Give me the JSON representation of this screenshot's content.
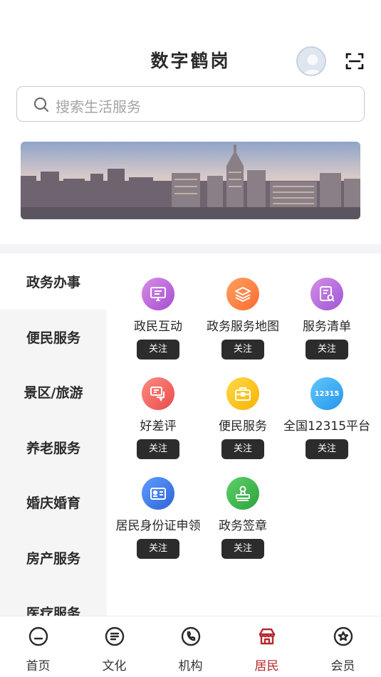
{
  "header": {
    "title": "数字鹤岗",
    "avatar_icon": "avatar",
    "scan_icon": "scan-icon"
  },
  "search": {
    "placeholder": "搜索生活服务"
  },
  "sidebar": {
    "items": [
      {
        "label": "政务办事",
        "active": true
      },
      {
        "label": "便民服务",
        "active": false
      },
      {
        "label": "景区/旅游",
        "active": false
      },
      {
        "label": "养老服务",
        "active": false
      },
      {
        "label": "婚庆婚育",
        "active": false
      },
      {
        "label": "房产服务",
        "active": false
      },
      {
        "label": "医疗服务",
        "active": false
      }
    ]
  },
  "services": [
    {
      "label": "政民互动",
      "icon": "screen-icon",
      "color": "#b760d6",
      "follow": "关注"
    },
    {
      "label": "政务服务地图",
      "icon": "layers-icon",
      "color": "#ff7b3d",
      "follow": "关注"
    },
    {
      "label": "服务清单",
      "icon": "list-search-icon",
      "color": "#b366d9",
      "follow": "关注"
    },
    {
      "label": "好差评",
      "icon": "comment-icon",
      "color": "#f06363",
      "follow": "关注"
    },
    {
      "label": "便民服务",
      "icon": "briefcase-icon",
      "color": "#f8c21a",
      "follow": "关注"
    },
    {
      "label": "全国12315平台",
      "icon": "12315-icon",
      "icon_text": "12315",
      "color": "#3aaaf0",
      "follow": "关注"
    },
    {
      "label": "居民身份证申领",
      "icon": "id-card-icon",
      "color": "#3a78e6",
      "follow": "关注"
    },
    {
      "label": "政务签章",
      "icon": "stamp-icon",
      "color": "#3db54a",
      "follow": "关注"
    }
  ],
  "tabbar": {
    "tabs": [
      {
        "label": "首页",
        "icon": "home-icon",
        "active": false
      },
      {
        "label": "文化",
        "icon": "document-icon",
        "active": false
      },
      {
        "label": "机构",
        "icon": "phone-icon",
        "active": false
      },
      {
        "label": "居民",
        "icon": "resident-icon",
        "active": true
      },
      {
        "label": "会员",
        "icon": "member-icon",
        "active": false
      }
    ]
  },
  "colors": {
    "accent": "#b4282d",
    "follow_bg": "#2c2c2c",
    "sidebar_bg": "#f5f5f5"
  }
}
